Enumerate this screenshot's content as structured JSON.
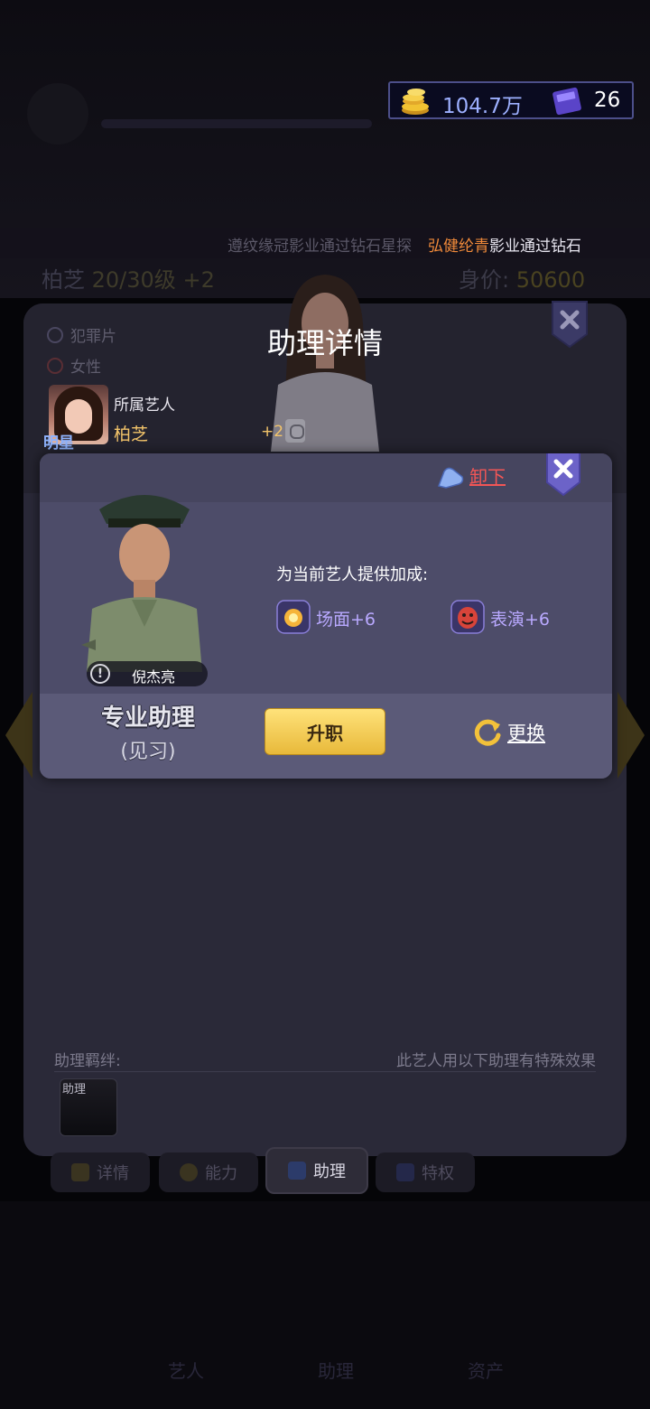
{
  "currency": {
    "coins": "104.7万",
    "books": "26"
  },
  "ticker": {
    "dim_text": "遵纹缘冠影业通过钻石星探",
    "highlight": "弘健纶青",
    "bright_text": "影业通过钻石"
  },
  "artist": {
    "name": "柏芝",
    "level": "20/30级",
    "level_bonus": "+2",
    "worth_label": "身价:",
    "worth_value": "50600",
    "tags": [
      "犯罪片",
      "女性"
    ]
  },
  "panel": {
    "title": "助理详情",
    "star_badge": "明星",
    "belong_label": "所属艺人",
    "belong_name": "柏芝",
    "bonus": "+2"
  },
  "assistant": {
    "unload_label": "卸下",
    "name": "倪杰亮",
    "info_symbol": "!",
    "bonus_title": "为当前艺人提供加成:",
    "bonuses": [
      {
        "label": "场面+6",
        "icon": "explosion-icon"
      },
      {
        "label": "表演+6",
        "icon": "drama-mask-icon"
      }
    ],
    "rank": "专业助理",
    "rank_sub": "(见习)",
    "promote_label": "升职",
    "swap_label": "更换"
  },
  "bond": {
    "label": "助理羁绊:",
    "note": "此艺人用以下助理有特殊效果",
    "card_label": "助理"
  },
  "tabs": [
    {
      "label": "详情",
      "active": false
    },
    {
      "label": "能力",
      "active": false
    },
    {
      "label": "助理",
      "active": true
    },
    {
      "label": "特权",
      "active": false
    }
  ],
  "bottom_nav": [
    "艺人",
    "助理",
    "资产"
  ],
  "colors": {
    "highlight_orange": "#f08a3a",
    "bonus_purple": "#b9a9ff",
    "unload_red": "#f25656",
    "promote_gold": "#f0c64a",
    "star_gold": "#f3c46a"
  }
}
